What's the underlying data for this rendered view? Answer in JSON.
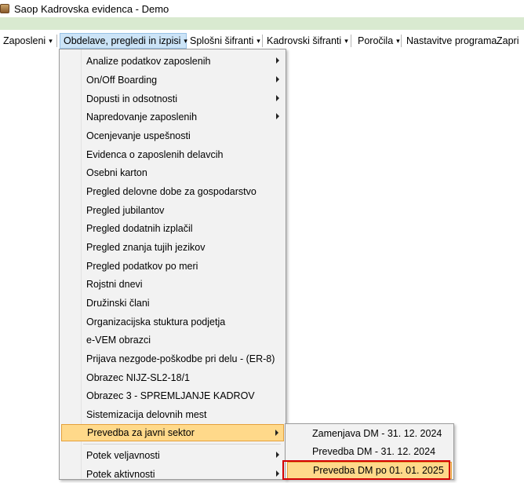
{
  "window": {
    "title": "Saop Kadrovska evidenca  - Demo",
    "icon": "app-icon"
  },
  "menubar": {
    "items": [
      {
        "label": "Zaposleni",
        "has_caret": true
      },
      {
        "label": "Obdelave, pregledi in izpisi",
        "has_caret": true,
        "active": true
      },
      {
        "label": "Splošni šifranti",
        "has_caret": true
      },
      {
        "label": "Kadrovski šifranti",
        "has_caret": true
      },
      {
        "label": "Poročila",
        "has_caret": true
      },
      {
        "label": "Nastavitve programa",
        "has_caret": false
      },
      {
        "label": "Zapri",
        "has_caret": false
      }
    ],
    "caret_glyph": "▾"
  },
  "dropdown": {
    "items": [
      {
        "label": "Analize podatkov zaposlenih",
        "submenu": true
      },
      {
        "label": "On/Off Boarding",
        "submenu": true
      },
      {
        "label": "Dopusti in odsotnosti",
        "submenu": true
      },
      {
        "label": "Napredovanje zaposlenih",
        "submenu": true
      },
      {
        "label": "Ocenjevanje uspešnosti"
      },
      {
        "label": "Evidenca o zaposlenih delavcih"
      },
      {
        "label": "Osebni karton"
      },
      {
        "label": "Pregled delovne dobe za gospodarstvo"
      },
      {
        "label": "Pregled jubilantov"
      },
      {
        "label": "Pregled dodatnih izplačil"
      },
      {
        "label": "Pregled znanja tujih jezikov"
      },
      {
        "label": "Pregled podatkov po meri"
      },
      {
        "label": "Rojstni dnevi"
      },
      {
        "label": "Družinski člani"
      },
      {
        "label": "Organizacijska stuktura podjetja"
      },
      {
        "label": "e-VEM obrazci"
      },
      {
        "label": "Prijava nezgode-poškodbe pri delu - (ER-8)"
      },
      {
        "label": "Obrazec NIJZ-SL2-18/1"
      },
      {
        "label": "Obrazec 3 - SPREMLJANJE KADROV"
      },
      {
        "label": "Sistemizacija delovnih mest"
      },
      {
        "label": "Prevedba za javni sektor",
        "submenu": true,
        "highlighted": true
      },
      {
        "label": "Potek veljavnosti",
        "submenu": true
      },
      {
        "label": "Potek aktivnosti",
        "submenu": true
      }
    ]
  },
  "submenu": {
    "items": [
      {
        "label": "Zamenjava DM - 31. 12. 2024"
      },
      {
        "label": "Prevedba DM - 31. 12. 2024"
      },
      {
        "label": "Prevedba DM po 01. 01. 2025",
        "highlighted": true
      }
    ]
  },
  "colors": {
    "highlight_bg": "#ffd98a",
    "highlight_border": "#e5a13b",
    "annotation_border": "#d40000",
    "active_menu_bg": "#cce4f7",
    "top_band": "#d9ead0"
  }
}
